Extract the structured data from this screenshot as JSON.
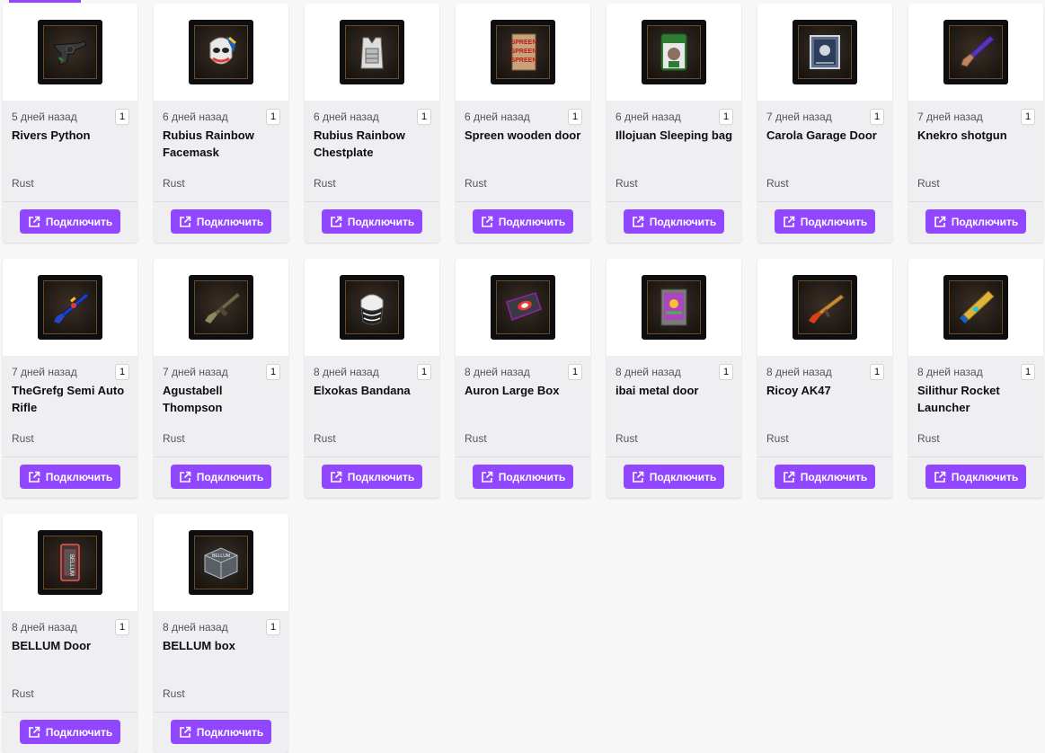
{
  "theme": {
    "accent": "#9147ff",
    "card_bg": "#efeff1",
    "thumb_bg": "#0e0e10"
  },
  "connect_label": "Подключить",
  "items": [
    {
      "date": "5 дней назад",
      "qty": "1",
      "name": "Rivers Python",
      "game": "Rust",
      "icon": "revolver-icon"
    },
    {
      "date": "6 дней назад",
      "qty": "1",
      "name": "Rubius Rainbow Facemask",
      "game": "Rust",
      "icon": "facemask-icon"
    },
    {
      "date": "6 дней назад",
      "qty": "1",
      "name": "Rubius Rainbow Chestplate",
      "game": "Rust",
      "icon": "chestplate-icon"
    },
    {
      "date": "6 дней назад",
      "qty": "1",
      "name": "Spreen wooden door",
      "game": "Rust",
      "icon": "wooden-door-icon"
    },
    {
      "date": "6 дней назад",
      "qty": "1",
      "name": "Illojuan Sleeping bag",
      "game": "Rust",
      "icon": "sleeping-bag-icon"
    },
    {
      "date": "7 дней назад",
      "qty": "1",
      "name": "Carola Garage Door",
      "game": "Rust",
      "icon": "garage-door-icon"
    },
    {
      "date": "7 дней назад",
      "qty": "1",
      "name": "Knekro shotgun",
      "game": "Rust",
      "icon": "shotgun-icon"
    },
    {
      "date": "7 дней назад",
      "qty": "1",
      "name": "TheGrefg Semi Auto Rifle",
      "game": "Rust",
      "icon": "rifle-icon"
    },
    {
      "date": "7 дней назад",
      "qty": "1",
      "name": "Agustabell Thompson",
      "game": "Rust",
      "icon": "thompson-icon"
    },
    {
      "date": "8 дней назад",
      "qty": "1",
      "name": "Elxokas Bandana",
      "game": "Rust",
      "icon": "bandana-icon"
    },
    {
      "date": "8 дней назад",
      "qty": "1",
      "name": "Auron Large Box",
      "game": "Rust",
      "icon": "large-box-icon"
    },
    {
      "date": "8 дней назад",
      "qty": "1",
      "name": "ibai metal door",
      "game": "Rust",
      "icon": "metal-door-icon"
    },
    {
      "date": "8 дней назад",
      "qty": "1",
      "name": "Ricoy AK47",
      "game": "Rust",
      "icon": "ak47-icon"
    },
    {
      "date": "8 дней назад",
      "qty": "1",
      "name": "Silithur Rocket Launcher",
      "game": "Rust",
      "icon": "rocket-launcher-icon"
    },
    {
      "date": "8 дней назад",
      "qty": "1",
      "name": "BELLUM Door",
      "game": "Rust",
      "icon": "door-icon"
    },
    {
      "date": "8 дней назад",
      "qty": "1",
      "name": "BELLUM box",
      "game": "Rust",
      "icon": "box-icon"
    }
  ]
}
